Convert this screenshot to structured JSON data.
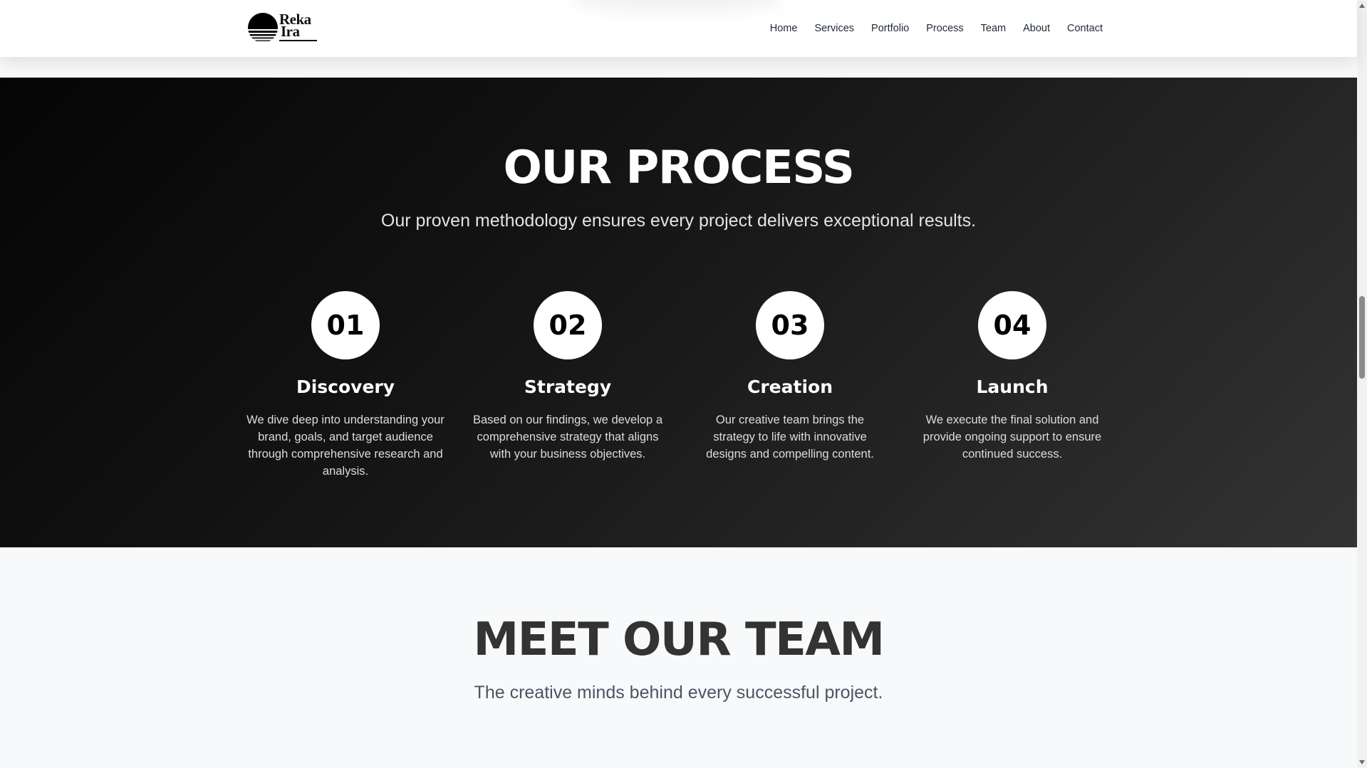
{
  "header": {
    "logo": {
      "line1": "Reka",
      "line2": "Ira"
    },
    "nav": [
      "Home",
      "Services",
      "Portfolio",
      "Process",
      "Team",
      "About",
      "Contact"
    ]
  },
  "process": {
    "title": "OUR PROCESS",
    "subtitle": "Our proven methodology ensures every project delivers exceptional results.",
    "steps": [
      {
        "number": "01",
        "title": "Discovery",
        "text": "We dive deep into understanding your brand, goals, and target audience through comprehensive research and analysis."
      },
      {
        "number": "02",
        "title": "Strategy",
        "text": "Based on our findings, we develop a comprehensive strategy that aligns with your business objectives."
      },
      {
        "number": "03",
        "title": "Creation",
        "text": "Our creative team brings the strategy to life with innovative designs and compelling content."
      },
      {
        "number": "04",
        "title": "Launch",
        "text": "We execute the final solution and provide ongoing support to ensure continued success."
      }
    ]
  },
  "team": {
    "title": "MEET OUR TEAM",
    "subtitle": "The creative minds behind every successful project."
  },
  "colors": {
    "process_bg_start": "#050505",
    "process_bg_end": "#333333",
    "team_bg": "#f8f9fa",
    "team_title": "#333333"
  }
}
